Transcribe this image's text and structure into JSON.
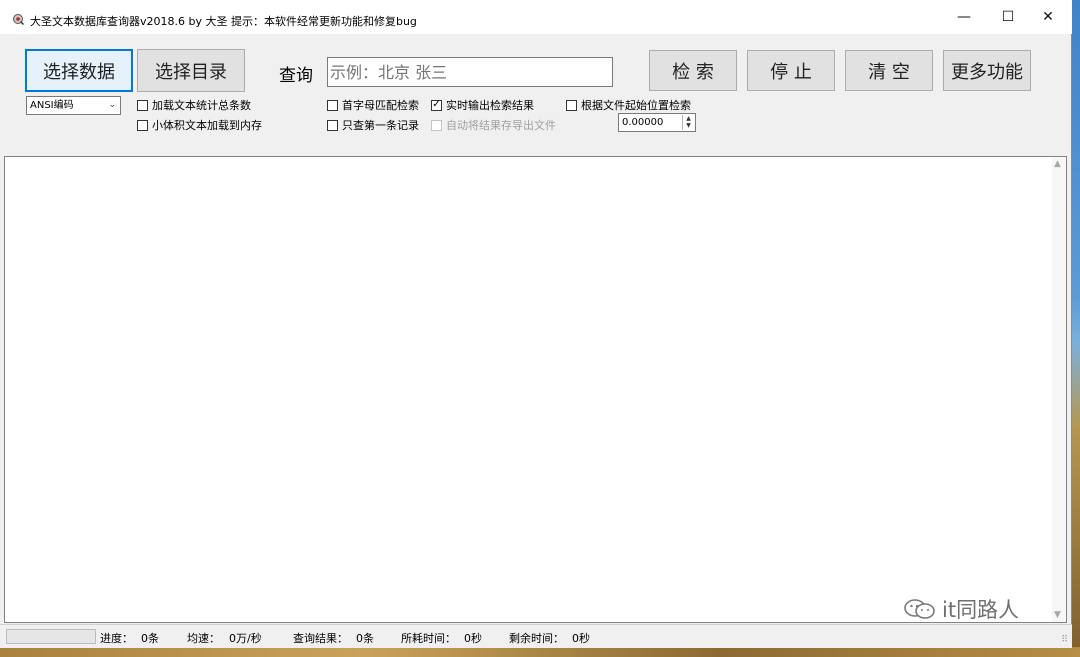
{
  "window": {
    "title": "大圣文本数据库查询器v2018.6  by 大圣  提示：本软件经常更新功能和修复bug",
    "minimize_glyph": "—",
    "maximize_glyph": "☐",
    "close_glyph": "✕"
  },
  "toolbar": {
    "select_data_label": "选择数据",
    "select_dir_label": "选择目录",
    "query_label": "查询",
    "query_value": "",
    "query_placeholder": "示例：北京 张三",
    "search_label": "检 索",
    "stop_label": "停 止",
    "clear_label": "清 空",
    "more_label": "更多功能"
  },
  "options": {
    "encoding": "ANSI编码",
    "load_count_label": "加载文本统计总条数",
    "load_count_checked": false,
    "small_to_memory_label": "小体积文本加载到内存",
    "small_to_memory_checked": false,
    "initial_match_label": "首字母匹配检索",
    "initial_match_checked": false,
    "first_only_label": "只查第一条记录",
    "first_only_checked": false,
    "realtime_output_label": "实时输出检索结果",
    "realtime_output_checked": true,
    "auto_export_label": "自动将结果存导出文件",
    "auto_export_checked": false,
    "auto_export_disabled": true,
    "start_position_label": "根据文件起始位置检索",
    "start_position_checked": false,
    "start_position_value": "0.00000"
  },
  "watermark": {
    "text": "it同路人",
    "icon": "wechat-icon"
  },
  "status": {
    "progress_fraction": 0,
    "progress_label": "进度：",
    "progress_value": "0条",
    "speed_label": "均速：",
    "speed_value": "0万/秒",
    "result_label": "查询结果：",
    "result_value": "0条",
    "elapsed_label": "所耗时间：",
    "elapsed_value": "0秒",
    "remaining_label": "剩余时间：",
    "remaining_value": "0秒"
  },
  "colors": {
    "accent": "#0078d7",
    "progress_green": "#06b025",
    "placeholder_gray": "#c3c3c3"
  }
}
